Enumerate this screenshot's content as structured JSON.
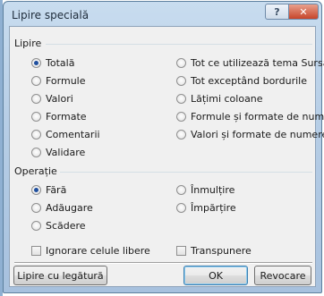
{
  "dialog": {
    "title": "Lipire specială",
    "help_glyph": "?",
    "close_glyph": "✕"
  },
  "paste": {
    "label": "Lipire",
    "left": [
      "Totală",
      "Formule",
      "Valori",
      "Formate",
      "Comentarii",
      "Validare"
    ],
    "right": [
      "Tot ce utilizează tema Sursă",
      "Tot exceptând bordurile",
      "Lățimi coloane",
      "Formule și formate de numere",
      "Valori și formate de numere"
    ],
    "selected": "Totală"
  },
  "operation": {
    "label": "Operație",
    "left": [
      "Fără",
      "Adăugare",
      "Scădere"
    ],
    "right": [
      "Înmulțire",
      "Împărțire"
    ],
    "selected": "Fără"
  },
  "checkboxes": {
    "skip_blanks": "Ignorare celule libere",
    "transpose": "Transpunere"
  },
  "buttons": {
    "paste_link": "Lipire cu legătură",
    "ok": "OK",
    "cancel": "Revocare"
  }
}
